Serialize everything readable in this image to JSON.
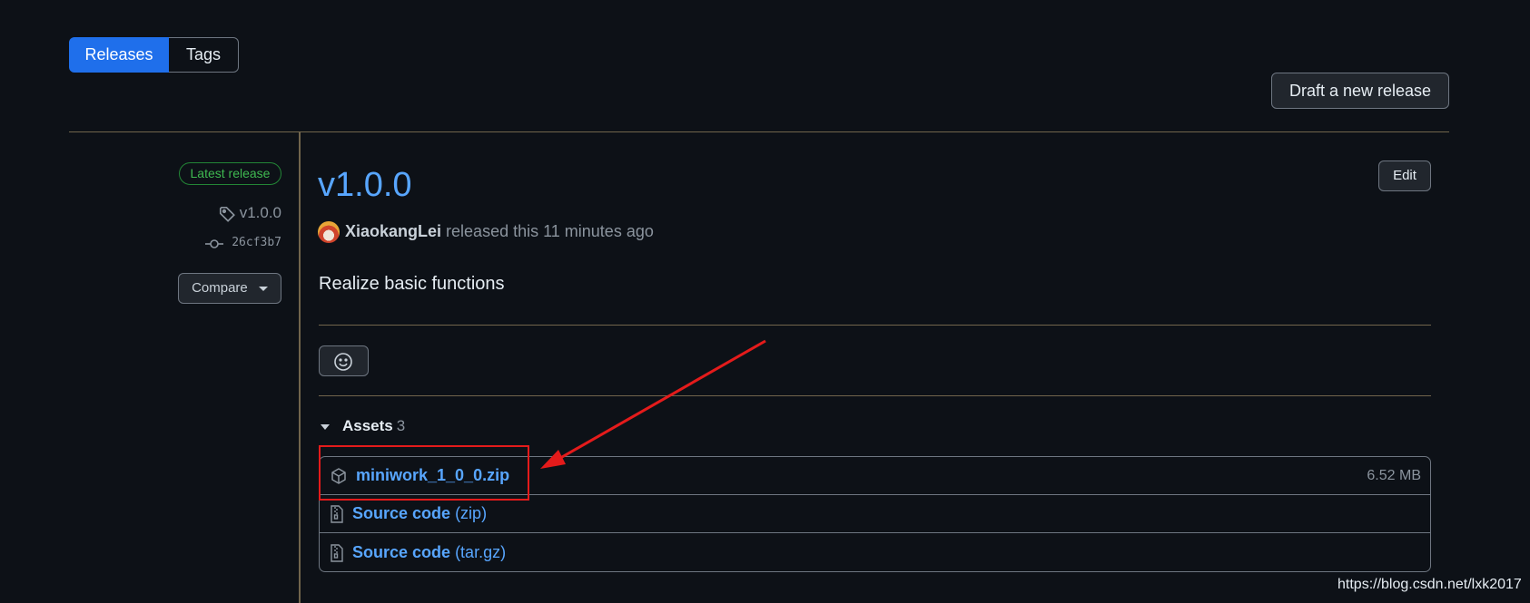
{
  "tabs": {
    "releases": "Releases",
    "tags": "Tags"
  },
  "actions": {
    "draft_release": "Draft a new release",
    "edit": "Edit",
    "compare": "Compare"
  },
  "sidebar": {
    "badge": "Latest release",
    "tag": "v1.0.0",
    "commit": "26cf3b7"
  },
  "release": {
    "title": "v1.0.0",
    "author": "XiaokangLei",
    "released_text": "released this 11 minutes ago",
    "body": "Realize basic functions"
  },
  "assets": {
    "label": "Assets",
    "count": "3",
    "items": [
      {
        "name": "miniwork_1_0_0.zip",
        "suffix": "",
        "size": "6.52 MB",
        "icon": "package-icon"
      },
      {
        "name": "Source code",
        "suffix": "(zip)",
        "size": "",
        "icon": "file-zip-icon"
      },
      {
        "name": "Source code",
        "suffix": "(tar.gz)",
        "size": "",
        "icon": "file-zip-icon"
      }
    ]
  },
  "watermark": "https://blog.csdn.net/lxk2017",
  "colors": {
    "accent": "#58a6ff",
    "primary": "#1f6feb",
    "success": "#3fb950",
    "annotation": "#e41b1b",
    "background": "#0d1117"
  }
}
